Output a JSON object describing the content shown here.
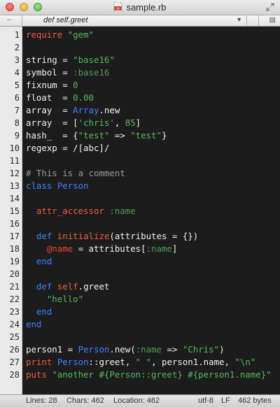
{
  "window": {
    "title": "sample.rb",
    "file_badge": "rb"
  },
  "jumpbar": {
    "marker": "–",
    "symbol": "def self.greet"
  },
  "status": {
    "lines": "Lines: 28",
    "chars": "Chars: 462",
    "location": "Location: 462",
    "encoding": "utf-8",
    "line_ending": "LF",
    "size": "462 bytes"
  },
  "theme": {
    "background": "#1c1c1c",
    "keyword": "#ee5d43",
    "function": "#3c82ff",
    "string": "#58b85a",
    "comment": "#9a9a9a"
  },
  "code_lines": [
    {
      "n": "1",
      "tokens": [
        [
          "kw",
          "require"
        ],
        [
          "",
          ""
        ],
        [
          "str",
          " \"gem\""
        ]
      ]
    },
    {
      "n": "2",
      "tokens": []
    },
    {
      "n": "3",
      "tokens": [
        [
          "",
          "string = "
        ],
        [
          "str",
          "\"base16\""
        ]
      ]
    },
    {
      "n": "4",
      "tokens": [
        [
          "",
          "symbol = "
        ],
        [
          "sym",
          ":base16"
        ]
      ]
    },
    {
      "n": "5",
      "tokens": [
        [
          "",
          "fixnum = "
        ],
        [
          "num",
          "0"
        ]
      ]
    },
    {
      "n": "6",
      "tokens": [
        [
          "",
          "float  = "
        ],
        [
          "num",
          "0.00"
        ]
      ]
    },
    {
      "n": "7",
      "tokens": [
        [
          "",
          "array  = "
        ],
        [
          "ctr",
          "Array"
        ],
        [
          "",
          ".new"
        ]
      ]
    },
    {
      "n": "8",
      "tokens": [
        [
          "",
          "array  = ["
        ],
        [
          "str",
          "'chris'"
        ],
        [
          "",
          ", "
        ],
        [
          "num",
          "85"
        ],
        [
          "",
          "]"
        ]
      ]
    },
    {
      "n": "9",
      "tokens": [
        [
          "",
          "hash_  = {"
        ],
        [
          "str",
          "\"test\""
        ],
        [
          "",
          " => "
        ],
        [
          "str",
          "\"test\""
        ],
        [
          "",
          "}"
        ]
      ]
    },
    {
      "n": "10",
      "tokens": [
        [
          "",
          "regexp = /[abc]/"
        ]
      ]
    },
    {
      "n": "11",
      "tokens": []
    },
    {
      "n": "12",
      "tokens": [
        [
          "cm",
          "# This is a comment"
        ]
      ]
    },
    {
      "n": "13",
      "tokens": [
        [
          "fn",
          "class"
        ],
        [
          "",
          ""
        ],
        [
          "fn",
          " Person"
        ]
      ]
    },
    {
      "n": "14",
      "tokens": []
    },
    {
      "n": "15",
      "tokens": [
        [
          "",
          "  "
        ],
        [
          "kw",
          "attr_accessor"
        ],
        [
          "sym",
          " :name"
        ]
      ]
    },
    {
      "n": "16",
      "tokens": []
    },
    {
      "n": "17",
      "tokens": [
        [
          "",
          "  "
        ],
        [
          "fn",
          "def"
        ],
        [
          "",
          ""
        ],
        [
          "kw",
          " initialize"
        ],
        [
          "",
          "(attributes = {})"
        ]
      ]
    },
    {
      "n": "18",
      "tokens": [
        [
          "",
          "    "
        ],
        [
          "ivar",
          "@name"
        ],
        [
          "",
          " = attributes["
        ],
        [
          "sym",
          ":name"
        ],
        [
          "",
          "]"
        ]
      ]
    },
    {
      "n": "19",
      "tokens": [
        [
          "",
          "  "
        ],
        [
          "fn",
          "end"
        ]
      ]
    },
    {
      "n": "20",
      "tokens": []
    },
    {
      "n": "21",
      "tokens": [
        [
          "",
          "  "
        ],
        [
          "fn",
          "def"
        ],
        [
          "",
          ""
        ],
        [
          "kw",
          " self"
        ],
        [
          "",
          ".greet"
        ]
      ]
    },
    {
      "n": "22",
      "tokens": [
        [
          "",
          "    "
        ],
        [
          "str",
          "\"hello\""
        ]
      ]
    },
    {
      "n": "23",
      "tokens": [
        [
          "",
          "  "
        ],
        [
          "fn",
          "end"
        ]
      ]
    },
    {
      "n": "24",
      "tokens": [
        [
          "fn",
          "end"
        ]
      ]
    },
    {
      "n": "25",
      "tokens": []
    },
    {
      "n": "26",
      "tokens": [
        [
          "",
          "person1 = "
        ],
        [
          "ctr",
          "Person"
        ],
        [
          "",
          ".new("
        ],
        [
          "sym",
          ":name"
        ],
        [
          "",
          " => "
        ],
        [
          "str",
          "\"Chris\""
        ],
        [
          "",
          ")"
        ]
      ]
    },
    {
      "n": "27",
      "tokens": [
        [
          "kw",
          "print"
        ],
        [
          "",
          ""
        ],
        [
          "ctr",
          " Person"
        ],
        [
          "",
          "::greet, "
        ],
        [
          "str",
          "\" \""
        ],
        [
          "",
          ", person1.name, "
        ],
        [
          "str",
          "\"\\n\""
        ]
      ]
    },
    {
      "n": "28",
      "tokens": [
        [
          "kw",
          "puts"
        ],
        [
          "",
          ""
        ],
        [
          "str",
          " \"another #{Person::greet} #{person1.name}\""
        ]
      ]
    }
  ]
}
